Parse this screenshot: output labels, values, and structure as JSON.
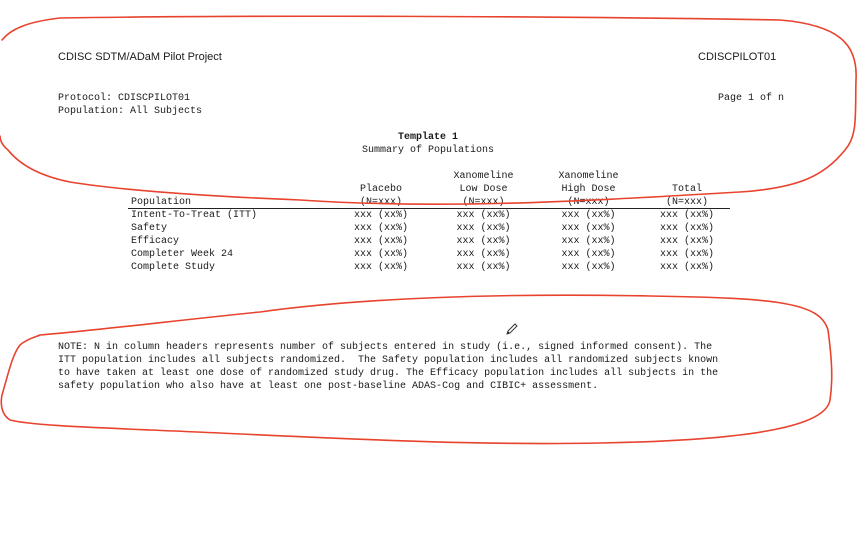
{
  "header": {
    "project": "CDISC SDTM/ADaM Pilot Project",
    "study_id": "CDISCPILOT01",
    "protocol": "Protocol: CDISCPILOT01",
    "population": "Population: All Subjects",
    "page": "Page 1 of n"
  },
  "title": {
    "line1": "Template 1",
    "line2": "Summary of Populations"
  },
  "table": {
    "header_row1": [
      "",
      "",
      "Xanomeline",
      "Xanomeline",
      ""
    ],
    "header_row2": [
      "",
      "Placebo",
      "Low Dose",
      "High Dose",
      "Total"
    ],
    "header_row3": [
      "Population",
      "(N=xxx)",
      "(N=xxx)",
      "(N=xxx)",
      "(N=xxx)"
    ],
    "rows": [
      [
        "Intent-To-Treat (ITT)",
        "xxx (xx%)",
        "xxx (xx%)",
        "xxx (xx%)",
        "xxx (xx%)"
      ],
      [
        "Safety",
        "xxx (xx%)",
        "xxx (xx%)",
        "xxx (xx%)",
        "xxx (xx%)"
      ],
      [
        "Efficacy",
        "xxx (xx%)",
        "xxx (xx%)",
        "xxx (xx%)",
        "xxx (xx%)"
      ],
      [
        "Completer Week 24",
        "xxx (xx%)",
        "xxx (xx%)",
        "xxx (xx%)",
        "xxx (xx%)"
      ],
      [
        "Complete Study",
        "xxx (xx%)",
        "xxx (xx%)",
        "xxx (xx%)",
        "xxx (xx%)"
      ]
    ]
  },
  "note": {
    "line1": "NOTE: N in column headers represents number of subjects entered in study (i.e., signed informed consent). The",
    "line2": "ITT population includes all subjects randomized.  The Safety population includes all randomized subjects known",
    "line3": "to have taken at least one dose of randomized study drug. The Efficacy population includes all subjects in the",
    "line4": "safety population who also have at least one post-baseline ADAS-Cog and CIBIC+ assessment."
  },
  "annotation": {
    "color": "#e8432e"
  }
}
